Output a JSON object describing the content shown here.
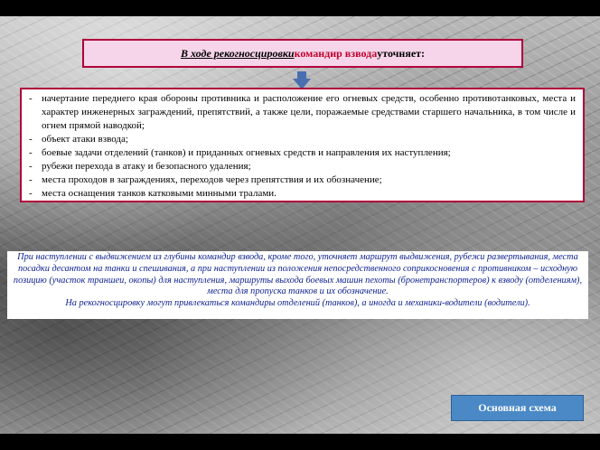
{
  "header": {
    "italic_part": "В ходе рекогносцировки",
    "red_part": " командир взвода",
    "rest_part": " уточняет:"
  },
  "items": [
    "начертание переднего края обороны противника и расположение его огневых средств, особенно противотанковых, места и характер инженерных заграждений, препятствий, а также цели, поражаемые средствами старшего начальника, в том числе и огнем прямой наводкой;",
    "объект атаки взвода;",
    "боевые задачи отделений (танков) и приданных огневых средств и направления их наступления;",
    "рубежи перехода в атаку и безопасного удаления;",
    "места проходов в заграждениях, переходов через препятствия и их обозначение;",
    "места оснащения танков катковыми минными тралами."
  ],
  "bullet": "-",
  "note": {
    "paragraph1": "При наступлении с выдвижением из глубины командир взвода, кроме того, уточняет маршрут выдвижения, рубежи развертывания, места посадки десантом на танки и спешивания, а при наступлении из положения непосредственного соприкосновения с противником – исходную позицию (участок траншеи, окопы) для наступления, маршруты выхода боевых машин пехоты (бронетранспортеров) к взводу (отделениям), места для пропуска танков и их обозначение.",
    "paragraph2": "На рекогносцировку могут привлекаться командиры отделений (танков), а иногда и механики-водители (водители)."
  },
  "nav_button": {
    "label": "Основная схема"
  },
  "colors": {
    "accent_red": "#b0003a",
    "title_bg": "#f6d5ea",
    "note_text": "#0a1f8f",
    "button_bg": "#4a89c6",
    "arrow": "#4a6fb0"
  },
  "icons": {
    "arrow": "down-arrow-icon"
  }
}
